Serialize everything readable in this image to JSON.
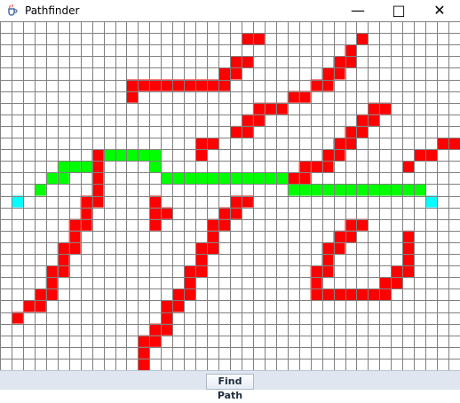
{
  "window": {
    "title": "Pathfinder",
    "controls": [
      "minimize",
      "maximize",
      "close"
    ],
    "app_icon": "java-cup-icon"
  },
  "grid": {
    "cols": 40,
    "rows": 30,
    "colors": {
      "background": "#ffffff",
      "line": "#808080",
      "wall": "#ff0000",
      "path": "#00ff00",
      "endpoint": "#00ffff"
    },
    "walls": [
      [
        21,
        1
      ],
      [
        22,
        1
      ],
      [
        31,
        1
      ],
      [
        30,
        2
      ],
      [
        20,
        3
      ],
      [
        21,
        3
      ],
      [
        29,
        3
      ],
      [
        30,
        3
      ],
      [
        19,
        4
      ],
      [
        20,
        4
      ],
      [
        28,
        4
      ],
      [
        29,
        4
      ],
      [
        11,
        5
      ],
      [
        12,
        5
      ],
      [
        13,
        5
      ],
      [
        14,
        5
      ],
      [
        15,
        5
      ],
      [
        16,
        5
      ],
      [
        17,
        5
      ],
      [
        18,
        5
      ],
      [
        19,
        5
      ],
      [
        27,
        5
      ],
      [
        28,
        5
      ],
      [
        11,
        6
      ],
      [
        25,
        6
      ],
      [
        26,
        6
      ],
      [
        22,
        7
      ],
      [
        23,
        7
      ],
      [
        24,
        7
      ],
      [
        32,
        7
      ],
      [
        33,
        7
      ],
      [
        21,
        8
      ],
      [
        22,
        8
      ],
      [
        31,
        8
      ],
      [
        32,
        8
      ],
      [
        20,
        9
      ],
      [
        21,
        9
      ],
      [
        30,
        9
      ],
      [
        31,
        9
      ],
      [
        38,
        10
      ],
      [
        39,
        10
      ],
      [
        17,
        10
      ],
      [
        18,
        10
      ],
      [
        29,
        10
      ],
      [
        30,
        10
      ],
      [
        17,
        11
      ],
      [
        28,
        11
      ],
      [
        29,
        11
      ],
      [
        36,
        11
      ],
      [
        37,
        11
      ],
      [
        8,
        11
      ],
      [
        8,
        12
      ],
      [
        26,
        12
      ],
      [
        27,
        12
      ],
      [
        28,
        12
      ],
      [
        35,
        12
      ],
      [
        8,
        13
      ],
      [
        25,
        13
      ],
      [
        26,
        13
      ],
      [
        8,
        14
      ],
      [
        8,
        15
      ],
      [
        7,
        15
      ],
      [
        13,
        15
      ],
      [
        14,
        16
      ],
      [
        20,
        15
      ],
      [
        21,
        15
      ],
      [
        7,
        16
      ],
      [
        13,
        16
      ],
      [
        19,
        16
      ],
      [
        20,
        16
      ],
      [
        13,
        17
      ],
      [
        6,
        17
      ],
      [
        7,
        17
      ],
      [
        18,
        17
      ],
      [
        19,
        17
      ],
      [
        30,
        17
      ],
      [
        31,
        17
      ],
      [
        6,
        18
      ],
      [
        18,
        18
      ],
      [
        29,
        18
      ],
      [
        30,
        18
      ],
      [
        35,
        18
      ],
      [
        5,
        19
      ],
      [
        6,
        19
      ],
      [
        17,
        19
      ],
      [
        18,
        19
      ],
      [
        28,
        19
      ],
      [
        29,
        19
      ],
      [
        35,
        19
      ],
      [
        5,
        20
      ],
      [
        17,
        20
      ],
      [
        28,
        20
      ],
      [
        35,
        20
      ],
      [
        4,
        21
      ],
      [
        5,
        21
      ],
      [
        16,
        21
      ],
      [
        17,
        21
      ],
      [
        27,
        21
      ],
      [
        28,
        21
      ],
      [
        34,
        21
      ],
      [
        35,
        21
      ],
      [
        4,
        22
      ],
      [
        16,
        22
      ],
      [
        27,
        22
      ],
      [
        33,
        22
      ],
      [
        34,
        22
      ],
      [
        3,
        23
      ],
      [
        4,
        23
      ],
      [
        15,
        23
      ],
      [
        16,
        23
      ],
      [
        27,
        23
      ],
      [
        28,
        23
      ],
      [
        29,
        23
      ],
      [
        30,
        23
      ],
      [
        31,
        23
      ],
      [
        32,
        23
      ],
      [
        33,
        23
      ],
      [
        2,
        24
      ],
      [
        3,
        24
      ],
      [
        14,
        24
      ],
      [
        15,
        24
      ],
      [
        1,
        25
      ],
      [
        14,
        25
      ],
      [
        13,
        26
      ],
      [
        14,
        26
      ],
      [
        12,
        27
      ],
      [
        13,
        27
      ],
      [
        12,
        28
      ],
      [
        12,
        29
      ]
    ],
    "path": [
      [
        9,
        11
      ],
      [
        10,
        11
      ],
      [
        11,
        11
      ],
      [
        12,
        11
      ],
      [
        13,
        11
      ],
      [
        5,
        12
      ],
      [
        6,
        12
      ],
      [
        7,
        12
      ],
      [
        13,
        12
      ],
      [
        4,
        13
      ],
      [
        5,
        13
      ],
      [
        14,
        13
      ],
      [
        15,
        13
      ],
      [
        16,
        13
      ],
      [
        17,
        13
      ],
      [
        18,
        13
      ],
      [
        19,
        13
      ],
      [
        20,
        13
      ],
      [
        21,
        13
      ],
      [
        22,
        13
      ],
      [
        23,
        13
      ],
      [
        24,
        13
      ],
      [
        3,
        14
      ],
      [
        25,
        14
      ],
      [
        26,
        14
      ],
      [
        27,
        14
      ],
      [
        28,
        14
      ],
      [
        29,
        14
      ],
      [
        30,
        14
      ],
      [
        31,
        14
      ],
      [
        32,
        14
      ],
      [
        33,
        14
      ],
      [
        34,
        14
      ],
      [
        35,
        14
      ],
      [
        36,
        14
      ]
    ],
    "endpoints": [
      [
        1,
        15
      ],
      [
        37,
        15
      ]
    ]
  },
  "footer": {
    "find_button_label": "Find Path"
  }
}
